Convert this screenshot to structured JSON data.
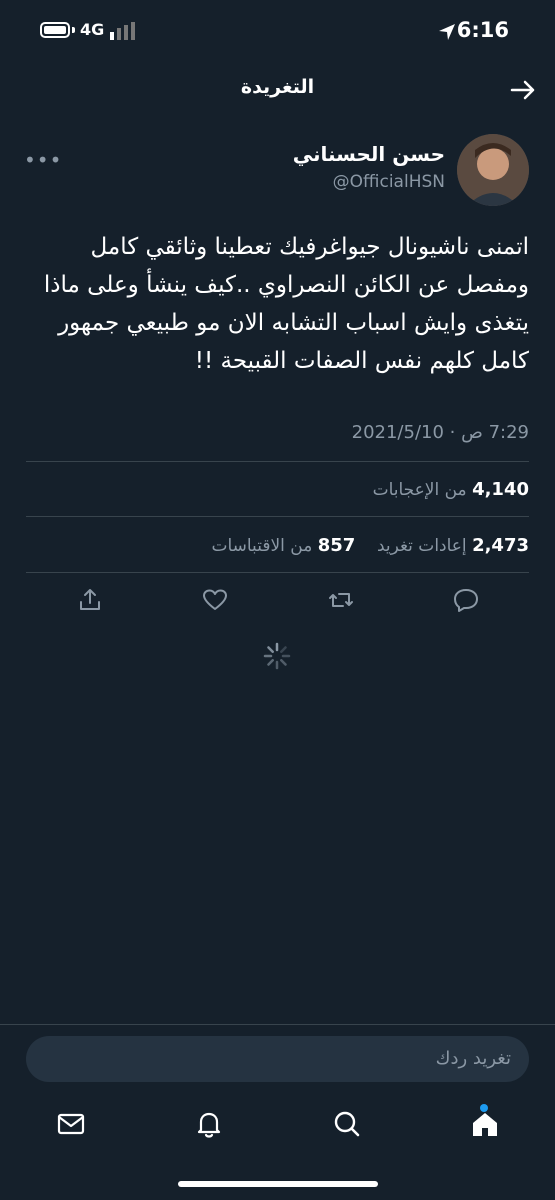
{
  "status_bar": {
    "time": "6:16",
    "network": "4G"
  },
  "header": {
    "title": "التغريدة"
  },
  "tweet": {
    "author_name": "حسن الحسناني",
    "author_handle": "@OfficialHSN",
    "text": "اتمنى ناشيونال جيواغرفيك تعطينا وثائقي كامل ومفصل عن الكائن النصراوي ..كيف ينشأ وعلى ماذا يتغذى وايش اسباب التشابه الان مو طبيعي جمهور كامل كلهم نفس الصفات القبيحة !!",
    "meta": "7:29 ص · 2021/5/10",
    "likes_count": "4,140",
    "likes_label": "من الإعجابات",
    "retweets_count": "2,473",
    "retweets_label": "إعادات تغريد",
    "quotes_count": "857",
    "quotes_label": "من الاقتباسات"
  },
  "reply": {
    "placeholder": "تغريد ردك"
  },
  "icons": [
    "back-arrow-icon",
    "more-icon",
    "reply-icon",
    "retweet-icon",
    "like-icon",
    "share-icon",
    "spinner-icon",
    "home-icon",
    "search-icon",
    "notifications-icon",
    "messages-icon"
  ],
  "colors": {
    "background": "#15202b",
    "secondary_text": "#8b98a5",
    "accent": "#1d9bf0"
  }
}
